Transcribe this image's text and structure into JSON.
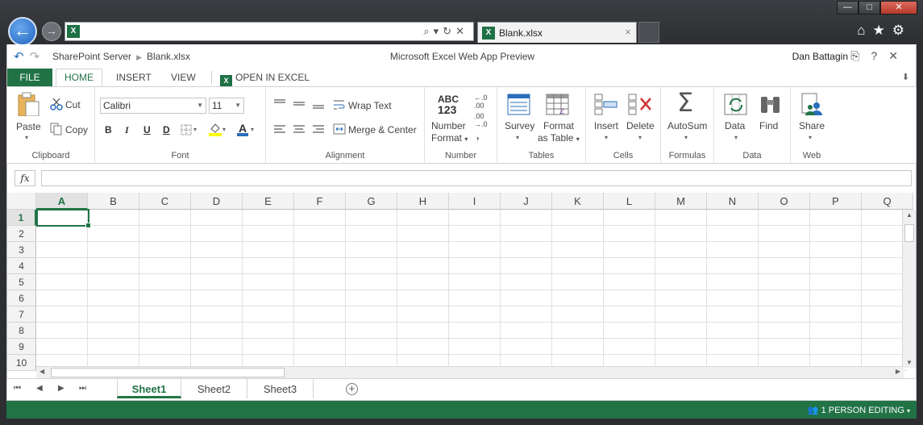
{
  "browser": {
    "address_url": "",
    "tab_title": "Blank.xlsx",
    "tab_close": "×",
    "window_buttons": [
      "—",
      "□",
      "✕"
    ],
    "toolbar_icons": [
      "home-icon",
      "star-icon",
      "gear-icon"
    ]
  },
  "app": {
    "breadcrumb_site": "SharePoint Server",
    "breadcrumb_file": "Blank.xlsx",
    "title": "Microsoft Excel Web App Preview",
    "user": "Dan Battagin",
    "help": "?"
  },
  "ribbon_tabs": {
    "file": "FILE",
    "home": "HOME",
    "insert": "INSERT",
    "view": "VIEW",
    "open_in_excel": "OPEN IN EXCEL"
  },
  "clipboard": {
    "paste": "Paste",
    "cut": "Cut",
    "copy": "Copy",
    "label": "Clipboard"
  },
  "font": {
    "name": "Calibri",
    "size": "11",
    "bold": "B",
    "italic": "I",
    "underline": "U",
    "double_underline": "D",
    "font_color_letter": "A",
    "label": "Font"
  },
  "alignment": {
    "wrap_text": "Wrap Text",
    "merge_center": "Merge & Center",
    "label": "Alignment"
  },
  "number": {
    "abc": "ABC",
    "num": "123",
    "format_line1": "Number",
    "format_line2": "Format",
    "label": "Number"
  },
  "tables": {
    "survey": "Survey",
    "format_line1": "Format",
    "format_line2": "as Table",
    "label": "Tables"
  },
  "cells": {
    "insert": "Insert",
    "delete": "Delete",
    "label": "Cells"
  },
  "formulas": {
    "autosum": "AutoSum",
    "sigma": "Σ",
    "label": "Formulas"
  },
  "data": {
    "data": "Data",
    "find": "Find",
    "label": "Data"
  },
  "web": {
    "share": "Share",
    "label": "Web"
  },
  "formula_bar": {
    "fx": "fx",
    "value": ""
  },
  "grid": {
    "columns": [
      "A",
      "B",
      "C",
      "D",
      "E",
      "F",
      "G",
      "H",
      "I",
      "J",
      "K",
      "L",
      "M",
      "N",
      "O",
      "P",
      "Q"
    ],
    "rows": [
      "1",
      "2",
      "3",
      "4",
      "5",
      "6",
      "7",
      "8",
      "9",
      "10"
    ],
    "active_cell": "A1"
  },
  "sheets": {
    "tabs": [
      "Sheet1",
      "Sheet2",
      "Sheet3"
    ],
    "active": "Sheet1",
    "add": "+"
  },
  "status": {
    "editing": "1 PERSON EDITING"
  },
  "colors": {
    "excel_green": "#217346",
    "chrome_dark": "#2c2e31",
    "accent_blue": "#2a6ebb"
  }
}
